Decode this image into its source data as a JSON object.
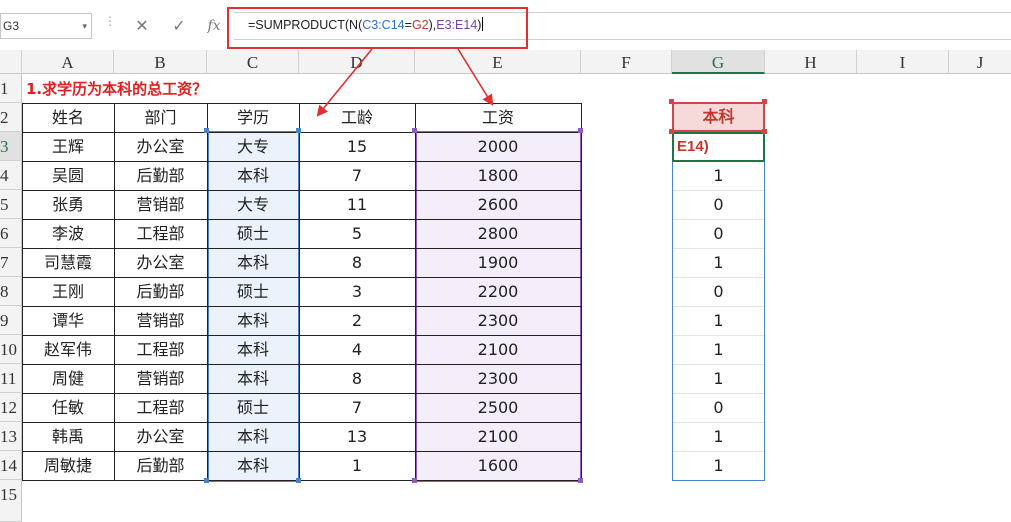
{
  "formula_bar": {
    "name_box": "G3",
    "name_box_arrow": "▾",
    "separator": "⋮",
    "cancel_icon": "✕",
    "enter_icon": "✓",
    "fx_icon": "fx",
    "formula_parts": [
      "=SUMPRODUCT(N(",
      "C3:C14",
      "=",
      "G2",
      "),",
      "E3:E14",
      ")"
    ]
  },
  "columns": [
    "A",
    "B",
    "C",
    "D",
    "E",
    "F",
    "G",
    "H",
    "I",
    "J"
  ],
  "rows": [
    "1",
    "2",
    "3",
    "4",
    "5",
    "6",
    "7",
    "8",
    "9",
    "10",
    "11",
    "12",
    "13",
    "14",
    "15"
  ],
  "selected_cell": "G3",
  "title": "1.求学历为本科的总工资？",
  "table": {
    "headers": [
      "姓名",
      "部门",
      "学历",
      "工龄",
      "工资"
    ],
    "rows": [
      [
        "王辉",
        "办公室",
        "大专",
        "15",
        "2000"
      ],
      [
        "吴圆",
        "后勤部",
        "本科",
        "7",
        "1800"
      ],
      [
        "张勇",
        "营销部",
        "大专",
        "11",
        "2600"
      ],
      [
        "李波",
        "工程部",
        "硕士",
        "5",
        "2800"
      ],
      [
        "司慧霞",
        "办公室",
        "本科",
        "8",
        "1900"
      ],
      [
        "王刚",
        "后勤部",
        "硕士",
        "3",
        "2200"
      ],
      [
        "谭华",
        "营销部",
        "本科",
        "2",
        "2300"
      ],
      [
        "赵军伟",
        "工程部",
        "本科",
        "4",
        "2100"
      ],
      [
        "周健",
        "营销部",
        "本科",
        "8",
        "2300"
      ],
      [
        "任敏",
        "工程部",
        "硕士",
        "7",
        "2500"
      ],
      [
        "韩禹",
        "办公室",
        "本科",
        "13",
        "2100"
      ],
      [
        "周敏捷",
        "后勤部",
        "本科",
        "1",
        "1600"
      ]
    ]
  },
  "g_column": {
    "header": "本科",
    "editing_text": "E14)",
    "values": [
      "1",
      "0",
      "0",
      "1",
      "0",
      "1",
      "1",
      "1",
      "0",
      "1",
      "1"
    ]
  },
  "colors": {
    "accent_green": "#217346",
    "ref_blue": "#2d6fbf",
    "ref_red": "#c0392b",
    "ref_purple": "#7b3fa8",
    "highlight_red": "#e03030"
  }
}
